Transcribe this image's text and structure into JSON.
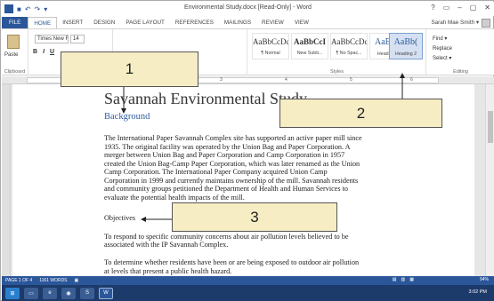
{
  "window": {
    "title": "Environmental Study.docx [Read-Only] - Word",
    "controls": [
      "?",
      "▭",
      "–",
      "▢",
      "✕"
    ]
  },
  "ribbon_tabs": [
    "FILE",
    "HOME",
    "INSERT",
    "DESIGN",
    "PAGE LAYOUT",
    "REFERENCES",
    "MAILINGS",
    "REVIEW",
    "VIEW"
  ],
  "user": {
    "name": "Sarah Mae Smith ▾"
  },
  "clipboard": {
    "paste_label": "Paste",
    "group_label": "Clipboard"
  },
  "font": {
    "name": "Times New R",
    "size": "14",
    "format_buttons": [
      "B",
      "I",
      "U"
    ]
  },
  "paragraph": {
    "group_label": "Paragraph"
  },
  "styles": {
    "group_label": "Styles",
    "items": [
      {
        "sample": "AaBbCcDc",
        "name": "¶ Normal"
      },
      {
        "sample": "AaBbCcI",
        "name": "New Subti..."
      },
      {
        "sample": "AaBbCcDc",
        "name": "¶ No Spac..."
      },
      {
        "sample": "AaBbC",
        "name": "Heading 1"
      },
      {
        "sample": "AaBb(",
        "name": "Heading 2"
      }
    ]
  },
  "editing": {
    "find": "Find ▾",
    "replace": "Replace",
    "select": "Select ▾",
    "group_label": "Editing"
  },
  "ruler": {
    "marks": [
      "1",
      "2",
      "3",
      "4",
      "5",
      "6"
    ]
  },
  "document": {
    "title": "Savannah Environmental Study",
    "heading": "Background",
    "paragraph_lines": [
      "The International Paper Savannah Complex site has supported an active paper mill since",
      "1935. The original facility was operated by the Union Bag and Paper Corporation. A",
      "merger between Union Bag and Paper Corporation and Camp Corporation in 1957",
      "created the Union Bag-Camp Paper Corporation, which was later renamed as the Union",
      "Camp Corporation. The International Paper Company acquired Union Camp",
      "Corporation in 1999 and currently maintains ownership of the mill. Savannah residents",
      "and community groups petitioned the Department of Health and Human Services to",
      "evaluate the potential health impacts of the mill."
    ],
    "objectives_heading": "Objectives",
    "objective_1_lines": [
      "To respond to specific community concerns about air pollution levels believed to be",
      "associated with the IP Savannah Complex."
    ],
    "objective_2_lines": [
      "To determine whether residents have been or are being exposed to outdoor air pollution",
      "at levels that present a public health hazard."
    ]
  },
  "callouts": [
    {
      "number": "1"
    },
    {
      "number": "2"
    },
    {
      "number": "3"
    }
  ],
  "status": {
    "page": "PAGE 1 OF 4",
    "words": "1161 WORDS",
    "zoom": "94%"
  },
  "taskbar": {
    "time": "3:02 PM"
  },
  "colors": {
    "accent": "#2b579a",
    "heading_blue": "#2e5d9e",
    "callout_fill": "#f6edc4"
  }
}
